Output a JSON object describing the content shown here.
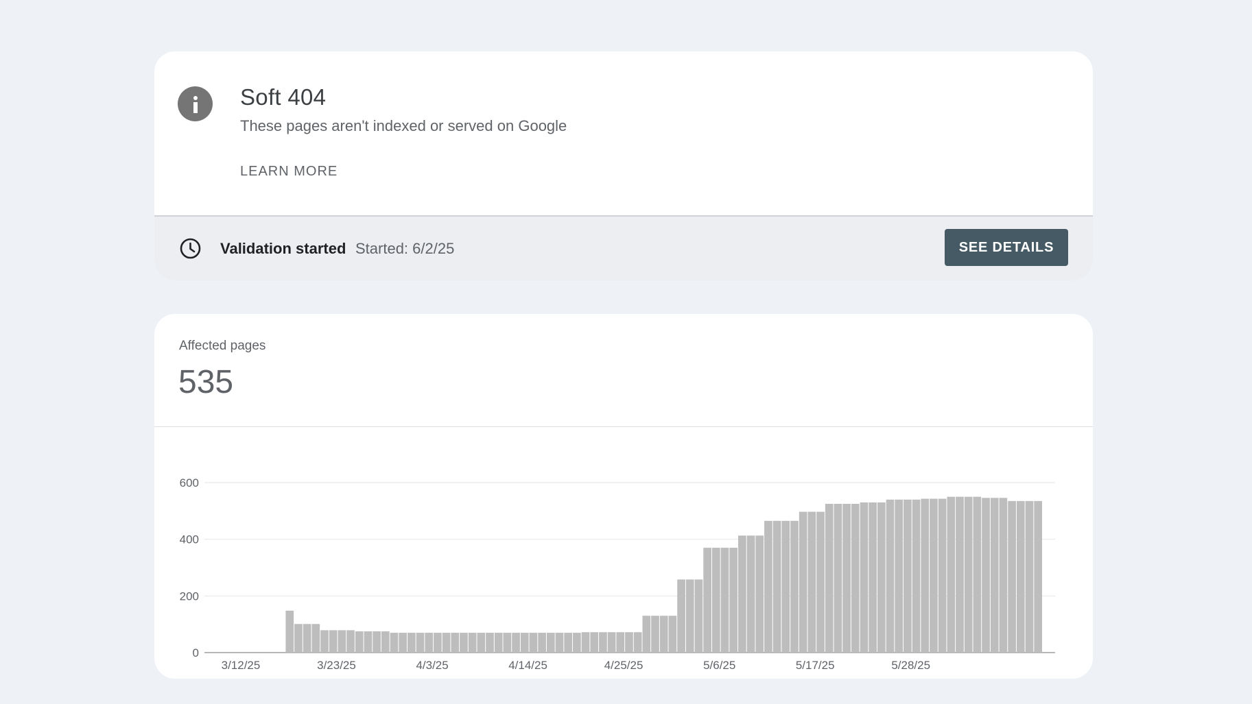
{
  "issue": {
    "title": "Soft 404",
    "subtitle": "These pages aren't indexed or served on Google",
    "learn_more": "LEARN MORE",
    "info_icon": "info-icon",
    "validation": {
      "status": "Validation started",
      "started": "Started: 6/2/25",
      "button": "SEE DETAILS",
      "icon": "clock-icon"
    }
  },
  "metric": {
    "label": "Affected pages",
    "value": "535"
  },
  "colors": {
    "bar": "#bdbdbd",
    "button": "#455a64",
    "info_icon": "#757575"
  },
  "chart_data": {
    "type": "bar",
    "title": "",
    "xlabel": "",
    "ylabel": "",
    "ylim": [
      0,
      600
    ],
    "y_ticks": [
      "0",
      "200",
      "400",
      "600"
    ],
    "x_ticks": [
      {
        "label": "3/12/25",
        "index": 0
      },
      {
        "label": "3/23/25",
        "index": 11
      },
      {
        "label": "4/3/25",
        "index": 22
      },
      {
        "label": "4/14/25",
        "index": 33
      },
      {
        "label": "4/25/25",
        "index": 44
      },
      {
        "label": "5/6/25",
        "index": 55
      },
      {
        "label": "5/17/25",
        "index": 66
      },
      {
        "label": "5/28/25",
        "index": 77
      }
    ],
    "grid": true,
    "values": [
      0,
      0,
      0,
      0,
      0,
      148,
      101,
      101,
      101,
      79,
      79,
      79,
      79,
      75,
      75,
      75,
      75,
      70,
      70,
      70,
      70,
      70,
      70,
      70,
      70,
      70,
      70,
      70,
      70,
      70,
      70,
      70,
      70,
      70,
      70,
      70,
      70,
      70,
      70,
      72,
      72,
      72,
      72,
      72,
      72,
      72,
      130,
      130,
      130,
      130,
      258,
      258,
      258,
      370,
      370,
      370,
      370,
      413,
      413,
      413,
      465,
      465,
      465,
      465,
      497,
      497,
      497,
      525,
      525,
      525,
      525,
      530,
      530,
      530,
      540,
      540,
      540,
      540,
      543,
      543,
      543,
      550,
      550,
      550,
      550,
      546,
      546,
      546,
      535,
      535,
      535,
      535
    ]
  }
}
